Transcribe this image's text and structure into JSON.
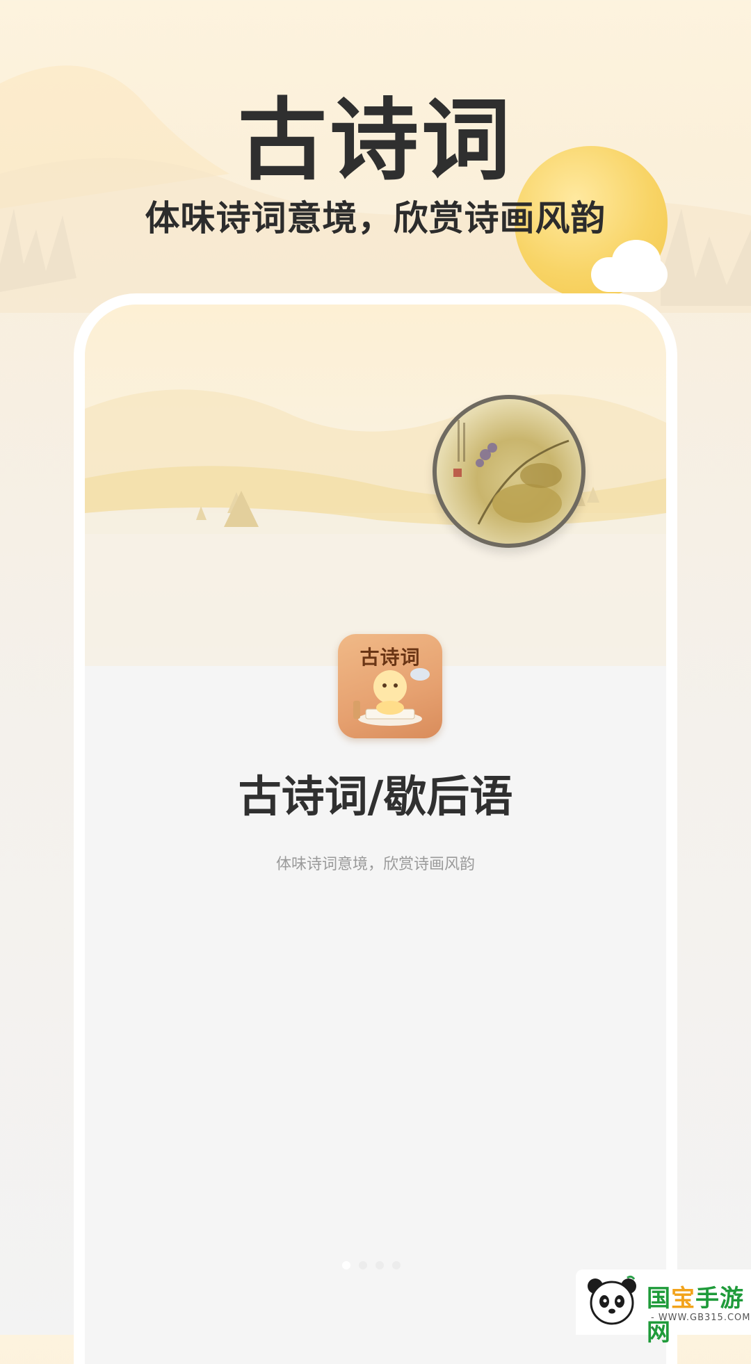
{
  "hero": {
    "title": "古诗词",
    "subtitle": "体味诗词意境，欣赏诗画风韵"
  },
  "app": {
    "icon_label": "古诗词",
    "name": "古诗词/歇后语",
    "slogan": "体味诗词意境，欣赏诗画风韵"
  },
  "pager": {
    "pages": 4,
    "active_index": 0
  },
  "watermark": {
    "brand": "国宝手游网",
    "brand_part1": "国",
    "brand_part2": "宝",
    "brand_part3": "手游网",
    "url": "- WWW.GB315.COM -"
  },
  "colors": {
    "title": "#2f2f2f",
    "accent_moon": "#f8d466",
    "background_top": "#fdf3de",
    "background_bottom": "#f3f3f3",
    "watermark_green": "#1f9b3a",
    "watermark_orange": "#f2a31b"
  }
}
